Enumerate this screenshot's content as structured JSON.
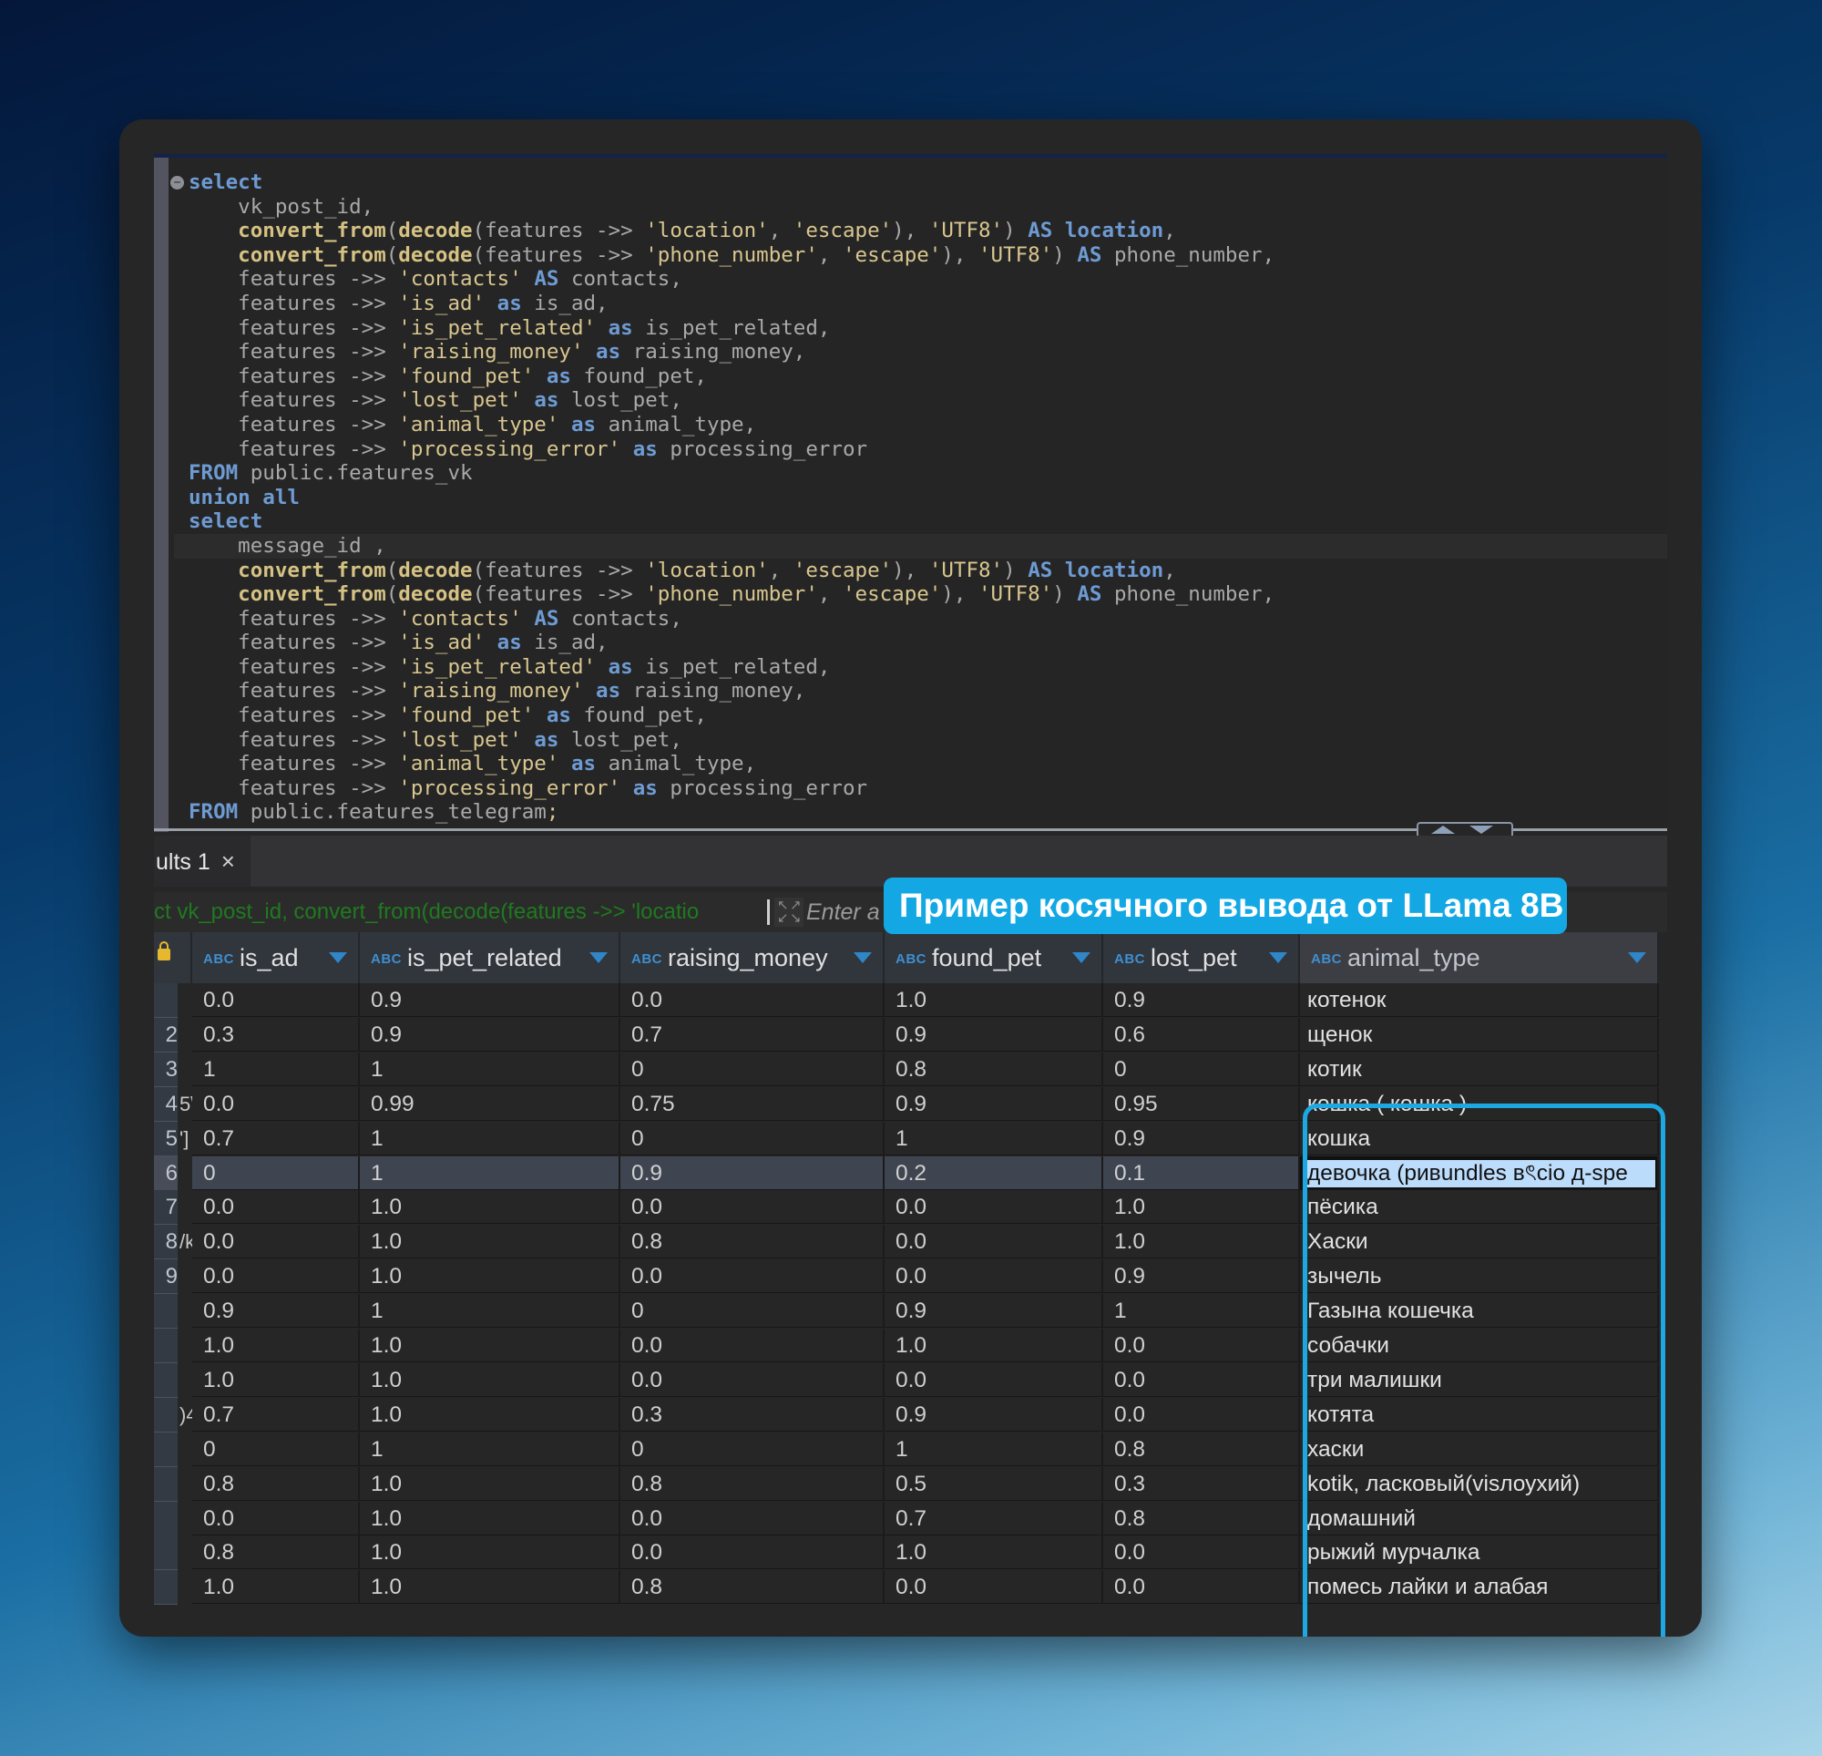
{
  "editor": {
    "lines": [
      [
        {
          "t": "kw",
          "v": "select"
        }
      ],
      [
        {
          "t": "id",
          "v": "    vk_post_id,"
        }
      ],
      [
        {
          "t": "fn",
          "v": "    convert_from"
        },
        {
          "t": "id",
          "v": "("
        },
        {
          "t": "fn",
          "v": "decode"
        },
        {
          "t": "id",
          "v": "(features ->> "
        },
        {
          "t": "str",
          "v": "'location'"
        },
        {
          "t": "id",
          "v": ", "
        },
        {
          "t": "str",
          "v": "'escape'"
        },
        {
          "t": "id",
          "v": "), "
        },
        {
          "t": "str",
          "v": "'UTF8'"
        },
        {
          "t": "id",
          "v": ") "
        },
        {
          "t": "kw",
          "v": "AS"
        },
        {
          "t": "id",
          "v": " "
        },
        {
          "t": "kwid",
          "v": "location"
        },
        {
          "t": "id",
          "v": ","
        }
      ],
      [
        {
          "t": "fn",
          "v": "    convert_from"
        },
        {
          "t": "id",
          "v": "("
        },
        {
          "t": "fn",
          "v": "decode"
        },
        {
          "t": "id",
          "v": "(features ->> "
        },
        {
          "t": "str",
          "v": "'phone_number'"
        },
        {
          "t": "id",
          "v": ", "
        },
        {
          "t": "str",
          "v": "'escape'"
        },
        {
          "t": "id",
          "v": "), "
        },
        {
          "t": "str",
          "v": "'UTF8'"
        },
        {
          "t": "id",
          "v": ") "
        },
        {
          "t": "kw",
          "v": "AS"
        },
        {
          "t": "id",
          "v": " phone_number,"
        }
      ],
      [
        {
          "t": "id",
          "v": "    features ->> "
        },
        {
          "t": "str",
          "v": "'contacts'"
        },
        {
          "t": "id",
          "v": " "
        },
        {
          "t": "kw",
          "v": "AS"
        },
        {
          "t": "id",
          "v": " contacts,"
        }
      ],
      [
        {
          "t": "id",
          "v": "    features ->> "
        },
        {
          "t": "str",
          "v": "'is_ad'"
        },
        {
          "t": "id",
          "v": " "
        },
        {
          "t": "kw",
          "v": "as"
        },
        {
          "t": "id",
          "v": " is_ad,"
        }
      ],
      [
        {
          "t": "id",
          "v": "    features ->> "
        },
        {
          "t": "str",
          "v": "'is_pet_related'"
        },
        {
          "t": "id",
          "v": " "
        },
        {
          "t": "kw",
          "v": "as"
        },
        {
          "t": "id",
          "v": " is_pet_related,"
        }
      ],
      [
        {
          "t": "id",
          "v": "    features ->> "
        },
        {
          "t": "str",
          "v": "'raising_money'"
        },
        {
          "t": "id",
          "v": " "
        },
        {
          "t": "kw",
          "v": "as"
        },
        {
          "t": "id",
          "v": " raising_money,"
        }
      ],
      [
        {
          "t": "id",
          "v": "    features ->> "
        },
        {
          "t": "str",
          "v": "'found_pet'"
        },
        {
          "t": "id",
          "v": " "
        },
        {
          "t": "kw",
          "v": "as"
        },
        {
          "t": "id",
          "v": " found_pet,"
        }
      ],
      [
        {
          "t": "id",
          "v": "    features ->> "
        },
        {
          "t": "str",
          "v": "'lost_pet'"
        },
        {
          "t": "id",
          "v": " "
        },
        {
          "t": "kw",
          "v": "as"
        },
        {
          "t": "id",
          "v": " lost_pet,"
        }
      ],
      [
        {
          "t": "id",
          "v": "    features ->> "
        },
        {
          "t": "str",
          "v": "'animal_type'"
        },
        {
          "t": "id",
          "v": " "
        },
        {
          "t": "kw",
          "v": "as"
        },
        {
          "t": "id",
          "v": " animal_type,"
        }
      ],
      [
        {
          "t": "id",
          "v": "    features ->> "
        },
        {
          "t": "str",
          "v": "'processing_error'"
        },
        {
          "t": "id",
          "v": " "
        },
        {
          "t": "kw",
          "v": "as"
        },
        {
          "t": "id",
          "v": " processing_error"
        }
      ],
      [
        {
          "t": "kw",
          "v": "FROM"
        },
        {
          "t": "id",
          "v": " public.features_vk"
        }
      ],
      [
        {
          "t": "kw",
          "v": "union all"
        }
      ],
      [
        {
          "t": "kw",
          "v": "select"
        }
      ],
      [
        {
          "t": "id",
          "v": "    message_id ,"
        }
      ],
      [
        {
          "t": "fn",
          "v": "    convert_from"
        },
        {
          "t": "id",
          "v": "("
        },
        {
          "t": "fn",
          "v": "decode"
        },
        {
          "t": "id",
          "v": "(features ->> "
        },
        {
          "t": "str",
          "v": "'location'"
        },
        {
          "t": "id",
          "v": ", "
        },
        {
          "t": "str",
          "v": "'escape'"
        },
        {
          "t": "id",
          "v": "), "
        },
        {
          "t": "str",
          "v": "'UTF8'"
        },
        {
          "t": "id",
          "v": ") "
        },
        {
          "t": "kw",
          "v": "AS"
        },
        {
          "t": "id",
          "v": " "
        },
        {
          "t": "kwid",
          "v": "location"
        },
        {
          "t": "id",
          "v": ","
        }
      ],
      [
        {
          "t": "fn",
          "v": "    convert_from"
        },
        {
          "t": "id",
          "v": "("
        },
        {
          "t": "fn",
          "v": "decode"
        },
        {
          "t": "id",
          "v": "(features ->> "
        },
        {
          "t": "str",
          "v": "'phone_number'"
        },
        {
          "t": "id",
          "v": ", "
        },
        {
          "t": "str",
          "v": "'escape'"
        },
        {
          "t": "id",
          "v": "), "
        },
        {
          "t": "str",
          "v": "'UTF8'"
        },
        {
          "t": "id",
          "v": ") "
        },
        {
          "t": "kw",
          "v": "AS"
        },
        {
          "t": "id",
          "v": " phone_number,"
        }
      ],
      [
        {
          "t": "id",
          "v": "    features ->> "
        },
        {
          "t": "str",
          "v": "'contacts'"
        },
        {
          "t": "id",
          "v": " "
        },
        {
          "t": "kw",
          "v": "AS"
        },
        {
          "t": "id",
          "v": " contacts,"
        }
      ],
      [
        {
          "t": "id",
          "v": "    features ->> "
        },
        {
          "t": "str",
          "v": "'is_ad'"
        },
        {
          "t": "id",
          "v": " "
        },
        {
          "t": "kw",
          "v": "as"
        },
        {
          "t": "id",
          "v": " is_ad,"
        }
      ],
      [
        {
          "t": "id",
          "v": "    features ->> "
        },
        {
          "t": "str",
          "v": "'is_pet_related'"
        },
        {
          "t": "id",
          "v": " "
        },
        {
          "t": "kw",
          "v": "as"
        },
        {
          "t": "id",
          "v": " is_pet_related,"
        }
      ],
      [
        {
          "t": "id",
          "v": "    features ->> "
        },
        {
          "t": "str",
          "v": "'raising_money'"
        },
        {
          "t": "id",
          "v": " "
        },
        {
          "t": "kw",
          "v": "as"
        },
        {
          "t": "id",
          "v": " raising_money,"
        }
      ],
      [
        {
          "t": "id",
          "v": "    features ->> "
        },
        {
          "t": "str",
          "v": "'found_pet'"
        },
        {
          "t": "id",
          "v": " "
        },
        {
          "t": "kw",
          "v": "as"
        },
        {
          "t": "id",
          "v": " found_pet,"
        }
      ],
      [
        {
          "t": "id",
          "v": "    features ->> "
        },
        {
          "t": "str",
          "v": "'lost_pet'"
        },
        {
          "t": "id",
          "v": " "
        },
        {
          "t": "kw",
          "v": "as"
        },
        {
          "t": "id",
          "v": " lost_pet,"
        }
      ],
      [
        {
          "t": "id",
          "v": "    features ->> "
        },
        {
          "t": "str",
          "v": "'animal_type'"
        },
        {
          "t": "id",
          "v": " "
        },
        {
          "t": "kw",
          "v": "as"
        },
        {
          "t": "id",
          "v": " animal_type,"
        }
      ],
      [
        {
          "t": "id",
          "v": "    features ->> "
        },
        {
          "t": "str",
          "v": "'processing_error'"
        },
        {
          "t": "id",
          "v": " "
        },
        {
          "t": "kw",
          "v": "as"
        },
        {
          "t": "id",
          "v": " processing_error"
        }
      ],
      [
        {
          "t": "kw",
          "v": "FROM"
        },
        {
          "t": "id",
          "v": " public.features_telegram"
        },
        {
          "t": "str",
          "v": ";"
        }
      ]
    ],
    "current_line": 15,
    "fold_icon": "collapse-minus-icon"
  },
  "results": {
    "tab_label": "ults 1",
    "close_icon": "×",
    "filter_query": "ct vk_post_id, convert_from(decode(features ->> 'locatio",
    "filter_placeholder": "Enter a",
    "expand_icon": "expand-arrows-icon"
  },
  "callout": {
    "text": "Пример косячного вывода от LLama 8B",
    "color": "#13a8e4"
  },
  "grid": {
    "type_badge": "ABC",
    "columns": [
      "is_ad",
      "is_pet_related",
      "raising_money",
      "found_pet",
      "lost_pet",
      "animal_type"
    ],
    "selected_row": 5,
    "rows": [
      {
        "num": "",
        "id": "",
        "is_ad": "0.0",
        "is_pet_related": "0.9",
        "raising_money": "0.0",
        "found_pet": "1.0",
        "lost_pet": "0.9",
        "animal_type": "котенок"
      },
      {
        "num": "2",
        "id": "",
        "is_ad": "0.3",
        "is_pet_related": "0.9",
        "raising_money": "0.7",
        "found_pet": "0.9",
        "lost_pet": "0.6",
        "animal_type": "щенок"
      },
      {
        "num": "3",
        "id": "",
        "is_ad": "1",
        "is_pet_related": "1",
        "raising_money": "0",
        "found_pet": "0.8",
        "lost_pet": "0",
        "animal_type": "котик"
      },
      {
        "num": "4",
        "id": "5\\",
        "is_ad": "0.0",
        "is_pet_related": "0.99",
        "raising_money": "0.75",
        "found_pet": "0.9",
        "lost_pet": "0.95",
        "animal_type": "кошка ( кошка )"
      },
      {
        "num": "5",
        "id": "']",
        "is_ad": "0.7",
        "is_pet_related": "1",
        "raising_money": "0",
        "found_pet": "1",
        "lost_pet": "0.9",
        "animal_type": "кошка"
      },
      {
        "num": "6",
        "id": "",
        "is_ad": "0",
        "is_pet_related": "1",
        "raising_money": "0.9",
        "found_pet": "0.2",
        "lost_pet": "0.1",
        "animal_type": "девочка (ривundles вৎcio д-spe"
      },
      {
        "num": "7",
        "id": "",
        "is_ad": "0.0",
        "is_pet_related": "1.0",
        "raising_money": "0.0",
        "found_pet": "0.0",
        "lost_pet": "1.0",
        "animal_type": "пёсика"
      },
      {
        "num": "8",
        "id": "/k",
        "is_ad": "0.0",
        "is_pet_related": "1.0",
        "raising_money": "0.8",
        "found_pet": "0.0",
        "lost_pet": "1.0",
        "animal_type": "Хаски"
      },
      {
        "num": "9",
        "id": "",
        "is_ad": "0.0",
        "is_pet_related": "1.0",
        "raising_money": "0.0",
        "found_pet": "0.0",
        "lost_pet": "0.9",
        "animal_type": "зычель"
      },
      {
        "num": "",
        "id": "",
        "is_ad": "0.9",
        "is_pet_related": "1",
        "raising_money": "0",
        "found_pet": "0.9",
        "lost_pet": "1",
        "animal_type": "Газына кошечка"
      },
      {
        "num": "",
        "id": "",
        "is_ad": "1.0",
        "is_pet_related": "1.0",
        "raising_money": "0.0",
        "found_pet": "1.0",
        "lost_pet": "0.0",
        "animal_type": "собачки"
      },
      {
        "num": "",
        "id": "",
        "is_ad": "1.0",
        "is_pet_related": "1.0",
        "raising_money": "0.0",
        "found_pet": "0.0",
        "lost_pet": "0.0",
        "animal_type": "три малишки"
      },
      {
        "num": "",
        "id": ")4",
        "is_ad": "0.7",
        "is_pet_related": "1.0",
        "raising_money": "0.3",
        "found_pet": "0.9",
        "lost_pet": "0.0",
        "animal_type": "котята"
      },
      {
        "num": "",
        "id": "",
        "is_ad": "0",
        "is_pet_related": "1",
        "raising_money": "0",
        "found_pet": "1",
        "lost_pet": "0.8",
        "animal_type": "хаски"
      },
      {
        "num": "",
        "id": "",
        "is_ad": "0.8",
        "is_pet_related": "1.0",
        "raising_money": "0.8",
        "found_pet": "0.5",
        "lost_pet": "0.3",
        "animal_type": "kotik, ласковый(visлоухий)"
      },
      {
        "num": "",
        "id": "",
        "is_ad": "0.0",
        "is_pet_related": "1.0",
        "raising_money": "0.0",
        "found_pet": "0.7",
        "lost_pet": "0.8",
        "animal_type": "домашний"
      },
      {
        "num": "",
        "id": "",
        "is_ad": "0.8",
        "is_pet_related": "1.0",
        "raising_money": "0.0",
        "found_pet": "1.0",
        "lost_pet": "0.0",
        "animal_type": "рыжий мурчалка"
      },
      {
        "num": "",
        "id": "",
        "is_ad": "1.0",
        "is_pet_related": "1.0",
        "raising_money": "0.8",
        "found_pet": "0.0",
        "lost_pet": "0.0",
        "animal_type": "помесь лайки и алабая"
      }
    ]
  }
}
